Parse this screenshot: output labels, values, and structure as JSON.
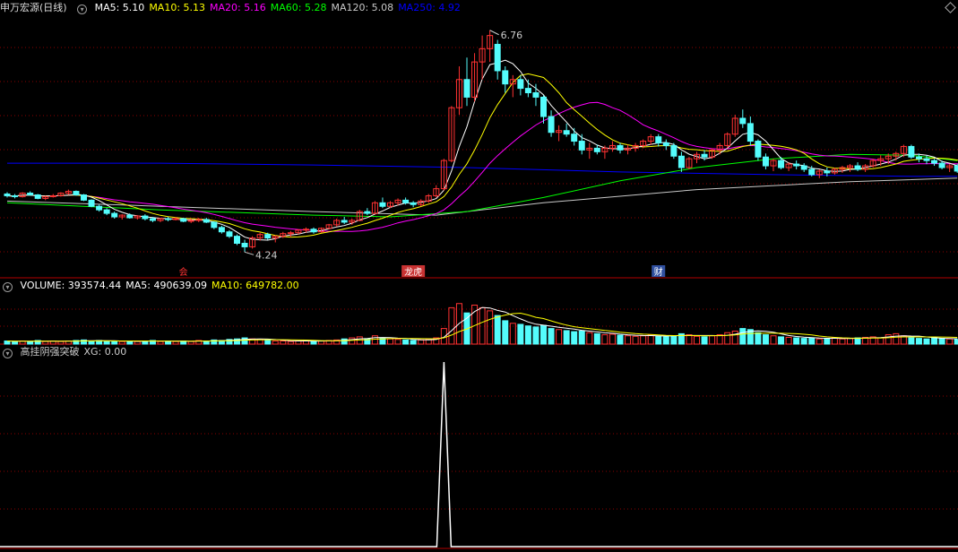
{
  "main_panel": {
    "title": "申万宏源(日线)",
    "ma_labels": [
      {
        "text": "MA5: 5.10",
        "color": "#ffffff"
      },
      {
        "text": "MA10: 5.13",
        "color": "#ffff00"
      },
      {
        "text": "MA20: 5.16",
        "color": "#ff00ff"
      },
      {
        "text": "MA60: 5.28",
        "color": "#00ff00"
      },
      {
        "text": "MA120: 5.08",
        "color": "#c8c8c8"
      },
      {
        "text": "MA250: 4.92",
        "color": "#0000ff"
      }
    ],
    "high_label": "6.76",
    "low_label": "4.24",
    "event_markers": [
      "会",
      "龙虎",
      "财"
    ]
  },
  "volume_panel": {
    "labels": [
      {
        "text": "VOLUME: 393574.44",
        "color": "#ffffff"
      },
      {
        "text": "MA5: 490639.09",
        "color": "#ffffff"
      },
      {
        "text": "MA10: 649782.00",
        "color": "#ffff00"
      }
    ]
  },
  "indicator_panel": {
    "labels": [
      {
        "text": "高挂阴强突破",
        "color": "#cccccc"
      },
      {
        "text": "XG: 0.00",
        "color": "#cccccc"
      }
    ]
  },
  "colors": {
    "up": "#ff3232",
    "down": "#54fcfc",
    "grid": "#8b0000",
    "border": "#b40000"
  },
  "chart_data": {
    "type": "candlestick",
    "title": "申万宏源(日线)",
    "ohlc": [
      [
        4.9,
        4.92,
        4.86,
        4.88
      ],
      [
        4.88,
        4.9,
        4.85,
        4.87
      ],
      [
        4.87,
        4.92,
        4.86,
        4.91
      ],
      [
        4.91,
        4.93,
        4.88,
        4.89
      ],
      [
        4.89,
        4.9,
        4.84,
        4.85
      ],
      [
        4.85,
        4.88,
        4.83,
        4.87
      ],
      [
        4.87,
        4.9,
        4.86,
        4.88
      ],
      [
        4.88,
        4.92,
        4.87,
        4.91
      ],
      [
        4.91,
        4.95,
        4.89,
        4.93
      ],
      [
        4.93,
        4.94,
        4.88,
        4.89
      ],
      [
        4.89,
        4.9,
        4.82,
        4.83
      ],
      [
        4.83,
        4.84,
        4.75,
        4.76
      ],
      [
        4.76,
        4.78,
        4.7,
        4.72
      ],
      [
        4.72,
        4.74,
        4.66,
        4.68
      ],
      [
        4.68,
        4.7,
        4.62,
        4.64
      ],
      [
        4.64,
        4.67,
        4.61,
        4.66
      ],
      [
        4.66,
        4.68,
        4.62,
        4.63
      ],
      [
        4.63,
        4.66,
        4.61,
        4.65
      ],
      [
        4.65,
        4.67,
        4.6,
        4.62
      ],
      [
        4.62,
        4.64,
        4.58,
        4.6
      ],
      [
        4.6,
        4.63,
        4.58,
        4.62
      ],
      [
        4.62,
        4.64,
        4.59,
        4.61
      ],
      [
        4.61,
        4.64,
        4.6,
        4.62
      ],
      [
        4.62,
        4.63,
        4.58,
        4.59
      ],
      [
        4.59,
        4.62,
        4.57,
        4.6
      ],
      [
        4.6,
        4.63,
        4.58,
        4.61
      ],
      [
        4.61,
        4.63,
        4.57,
        4.58
      ],
      [
        4.58,
        4.59,
        4.5,
        4.52
      ],
      [
        4.52,
        4.54,
        4.45,
        4.47
      ],
      [
        4.47,
        4.49,
        4.4,
        4.42
      ],
      [
        4.42,
        4.44,
        4.32,
        4.34
      ],
      [
        4.34,
        4.38,
        4.24,
        4.3
      ],
      [
        4.3,
        4.42,
        4.28,
        4.4
      ],
      [
        4.4,
        4.46,
        4.37,
        4.44
      ],
      [
        4.44,
        4.46,
        4.38,
        4.4
      ],
      [
        4.4,
        4.43,
        4.35,
        4.42
      ],
      [
        4.42,
        4.47,
        4.4,
        4.45
      ],
      [
        4.45,
        4.48,
        4.41,
        4.46
      ],
      [
        4.46,
        4.5,
        4.44,
        4.49
      ],
      [
        4.49,
        4.52,
        4.46,
        4.5
      ],
      [
        4.5,
        4.52,
        4.45,
        4.47
      ],
      [
        4.47,
        4.52,
        4.46,
        4.51
      ],
      [
        4.51,
        4.56,
        4.5,
        4.55
      ],
      [
        4.55,
        4.62,
        4.53,
        4.6
      ],
      [
        4.6,
        4.64,
        4.56,
        4.58
      ],
      [
        4.58,
        4.62,
        4.55,
        4.6
      ],
      [
        4.6,
        4.72,
        4.59,
        4.7
      ],
      [
        4.7,
        4.74,
        4.66,
        4.68
      ],
      [
        4.68,
        4.82,
        4.67,
        4.8
      ],
      [
        4.8,
        4.86,
        4.74,
        4.76
      ],
      [
        4.76,
        4.82,
        4.74,
        4.8
      ],
      [
        4.8,
        4.85,
        4.77,
        4.83
      ],
      [
        4.83,
        4.86,
        4.78,
        4.8
      ],
      [
        4.8,
        4.82,
        4.75,
        4.78
      ],
      [
        4.78,
        4.84,
        4.76,
        4.82
      ],
      [
        4.82,
        4.9,
        4.8,
        4.88
      ],
      [
        4.88,
        5.0,
        4.86,
        4.96
      ],
      [
        4.96,
        5.3,
        4.94,
        5.28
      ],
      [
        5.28,
        5.9,
        5.26,
        5.88
      ],
      [
        5.88,
        6.35,
        5.8,
        6.2
      ],
      [
        6.2,
        6.45,
        5.9,
        6.0
      ],
      [
        6.0,
        6.5,
        5.95,
        6.4
      ],
      [
        6.4,
        6.7,
        6.2,
        6.55
      ],
      [
        6.55,
        6.76,
        6.4,
        6.7
      ],
      [
        6.6,
        6.65,
        6.2,
        6.3
      ],
      [
        6.3,
        6.35,
        6.05,
        6.15
      ],
      [
        6.15,
        6.25,
        6.0,
        6.2
      ],
      [
        6.2,
        6.25,
        6.02,
        6.1
      ],
      [
        6.1,
        6.2,
        6.0,
        6.05
      ],
      [
        6.05,
        6.15,
        5.9,
        6.0
      ],
      [
        6.0,
        6.02,
        5.7,
        5.78
      ],
      [
        5.78,
        5.85,
        5.55,
        5.6
      ],
      [
        5.6,
        5.68,
        5.5,
        5.62
      ],
      [
        5.62,
        5.7,
        5.55,
        5.58
      ],
      [
        5.58,
        5.65,
        5.45,
        5.5
      ],
      [
        5.5,
        5.58,
        5.35,
        5.4
      ],
      [
        5.4,
        5.48,
        5.3,
        5.42
      ],
      [
        5.42,
        5.46,
        5.35,
        5.38
      ],
      [
        5.38,
        5.45,
        5.3,
        5.42
      ],
      [
        5.42,
        5.5,
        5.38,
        5.45
      ],
      [
        5.45,
        5.48,
        5.36,
        5.4
      ],
      [
        5.4,
        5.46,
        5.35,
        5.42
      ],
      [
        5.42,
        5.48,
        5.38,
        5.45
      ],
      [
        5.45,
        5.52,
        5.42,
        5.5
      ],
      [
        5.5,
        5.58,
        5.46,
        5.55
      ],
      [
        5.55,
        5.58,
        5.44,
        5.48
      ],
      [
        5.48,
        5.52,
        5.4,
        5.45
      ],
      [
        5.45,
        5.48,
        5.3,
        5.33
      ],
      [
        5.33,
        5.38,
        5.15,
        5.2
      ],
      [
        5.2,
        5.32,
        5.18,
        5.3
      ],
      [
        5.3,
        5.38,
        5.25,
        5.35
      ],
      [
        5.35,
        5.4,
        5.28,
        5.32
      ],
      [
        5.32,
        5.42,
        5.3,
        5.4
      ],
      [
        5.4,
        5.48,
        5.35,
        5.45
      ],
      [
        5.45,
        5.6,
        5.42,
        5.58
      ],
      [
        5.58,
        5.8,
        5.55,
        5.76
      ],
      [
        5.76,
        5.86,
        5.65,
        5.7
      ],
      [
        5.7,
        5.78,
        5.45,
        5.5
      ],
      [
        5.5,
        5.52,
        5.28,
        5.32
      ],
      [
        5.32,
        5.36,
        5.18,
        5.22
      ],
      [
        5.22,
        5.3,
        5.16,
        5.28
      ],
      [
        5.28,
        5.32,
        5.18,
        5.2
      ],
      [
        5.2,
        5.26,
        5.16,
        5.24
      ],
      [
        5.24,
        5.28,
        5.18,
        5.22
      ],
      [
        5.22,
        5.25,
        5.15,
        5.18
      ],
      [
        5.18,
        5.22,
        5.1,
        5.12
      ],
      [
        5.12,
        5.18,
        5.08,
        5.16
      ],
      [
        5.16,
        5.2,
        5.1,
        5.14
      ],
      [
        5.14,
        5.2,
        5.12,
        5.18
      ],
      [
        5.18,
        5.22,
        5.14,
        5.2
      ],
      [
        5.2,
        5.24,
        5.15,
        5.22
      ],
      [
        5.22,
        5.26,
        5.16,
        5.18
      ],
      [
        5.18,
        5.24,
        5.15,
        5.22
      ],
      [
        5.22,
        5.3,
        5.2,
        5.28
      ],
      [
        5.28,
        5.34,
        5.22,
        5.3
      ],
      [
        5.3,
        5.36,
        5.24,
        5.33
      ],
      [
        5.33,
        5.38,
        5.28,
        5.36
      ],
      [
        5.36,
        5.46,
        5.32,
        5.44
      ],
      [
        5.44,
        5.46,
        5.3,
        5.32
      ],
      [
        5.32,
        5.36,
        5.26,
        5.3
      ],
      [
        5.3,
        5.34,
        5.24,
        5.28
      ],
      [
        5.28,
        5.3,
        5.22,
        5.25
      ],
      [
        5.25,
        5.28,
        5.18,
        5.2
      ],
      [
        5.2,
        5.24,
        5.15,
        5.22
      ],
      [
        5.22,
        5.24,
        5.14,
        5.16
      ],
      [
        5.16,
        5.2,
        5.1,
        5.12
      ],
      [
        5.12,
        5.16,
        5.08,
        5.1
      ]
    ],
    "ma_series": [
      {
        "name": "MA5",
        "color": "#ffffff",
        "last": 5.1
      },
      {
        "name": "MA10",
        "color": "#ffff00",
        "last": 5.13
      },
      {
        "name": "MA20",
        "color": "#ff00ff",
        "last": 5.16
      },
      {
        "name": "MA60",
        "color": "#00ff00",
        "last": 5.28
      },
      {
        "name": "MA120",
        "color": "#c8c8c8",
        "last": 5.08
      },
      {
        "name": "MA250",
        "color": "#0000ff",
        "last": 4.92
      }
    ],
    "ma250_path": [
      [
        0,
        5.25
      ],
      [
        20,
        5.25
      ],
      [
        40,
        5.23
      ],
      [
        60,
        5.2
      ],
      [
        80,
        5.15
      ],
      [
        100,
        5.12
      ],
      [
        118,
        5.1
      ],
      [
        124,
        5.1
      ]
    ],
    "ma120_path": [
      [
        0,
        4.82
      ],
      [
        20,
        4.76
      ],
      [
        40,
        4.7
      ],
      [
        56,
        4.66
      ],
      [
        70,
        4.8
      ],
      [
        90,
        4.95
      ],
      [
        110,
        5.04
      ],
      [
        124,
        5.08
      ]
    ],
    "ma60_path": [
      [
        0,
        4.8
      ],
      [
        20,
        4.72
      ],
      [
        40,
        4.66
      ],
      [
        50,
        4.64
      ],
      [
        60,
        4.7
      ],
      [
        70,
        4.86
      ],
      [
        80,
        5.05
      ],
      [
        90,
        5.2
      ],
      [
        100,
        5.3
      ],
      [
        110,
        5.35
      ],
      [
        118,
        5.34
      ],
      [
        124,
        5.28
      ]
    ],
    "annotations": [
      {
        "label": "6.76",
        "bar": 63,
        "value": 6.76
      },
      {
        "label": "4.24",
        "bar": 31,
        "value": 4.24
      }
    ],
    "volume": {
      "name": "VOLUME",
      "last": 393574.44,
      "ma5": 490639.09,
      "ma10": 649782.0,
      "heights_rel": [
        0.06,
        0.05,
        0.06,
        0.05,
        0.07,
        0.05,
        0.06,
        0.05,
        0.06,
        0.07,
        0.08,
        0.06,
        0.07,
        0.05,
        0.06,
        0.05,
        0.06,
        0.05,
        0.06,
        0.07,
        0.05,
        0.06,
        0.05,
        0.06,
        0.05,
        0.07,
        0.06,
        0.08,
        0.07,
        0.09,
        0.1,
        0.12,
        0.1,
        0.09,
        0.07,
        0.06,
        0.06,
        0.05,
        0.06,
        0.07,
        0.05,
        0.06,
        0.07,
        0.08,
        0.1,
        0.12,
        0.14,
        0.1,
        0.16,
        0.12,
        0.1,
        0.09,
        0.08,
        0.07,
        0.08,
        0.09,
        0.12,
        0.3,
        0.7,
        0.78,
        0.6,
        0.75,
        0.7,
        0.64,
        0.55,
        0.45,
        0.4,
        0.38,
        0.35,
        0.33,
        0.36,
        0.3,
        0.28,
        0.26,
        0.24,
        0.25,
        0.22,
        0.2,
        0.18,
        0.19,
        0.17,
        0.16,
        0.15,
        0.16,
        0.18,
        0.15,
        0.14,
        0.16,
        0.2,
        0.18,
        0.15,
        0.14,
        0.16,
        0.18,
        0.22,
        0.25,
        0.3,
        0.28,
        0.22,
        0.18,
        0.16,
        0.14,
        0.13,
        0.12,
        0.11,
        0.12,
        0.1,
        0.11,
        0.12,
        0.1,
        0.11,
        0.12,
        0.13,
        0.14,
        0.12,
        0.18,
        0.2,
        0.16,
        0.12,
        0.11,
        0.1,
        0.12,
        0.11,
        0.1,
        0.09
      ]
    },
    "indicator": {
      "name": "高挂阴强突破",
      "series": "XG",
      "last": 0.0,
      "spike_bar": 57,
      "spike_value": 1
    }
  }
}
